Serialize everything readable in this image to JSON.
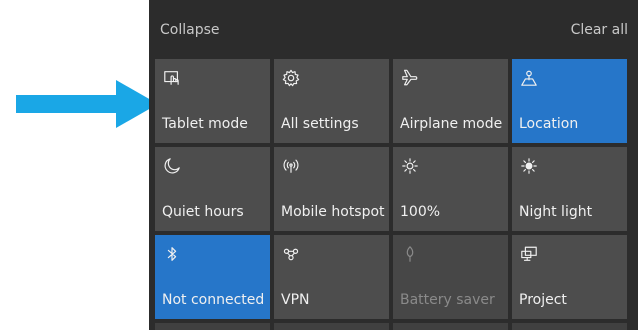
{
  "header": {
    "collapse_label": "Collapse",
    "clear_all_label": "Clear all"
  },
  "tiles": [
    {
      "label": "Tablet mode",
      "icon": "tablet-mode-icon",
      "state": "off"
    },
    {
      "label": "All settings",
      "icon": "gear-icon",
      "state": "off"
    },
    {
      "label": "Airplane mode",
      "icon": "airplane-icon",
      "state": "off"
    },
    {
      "label": "Location",
      "icon": "location-icon",
      "state": "on"
    },
    {
      "label": "Quiet hours",
      "icon": "moon-icon",
      "state": "off"
    },
    {
      "label": "Mobile hotspot",
      "icon": "hotspot-icon",
      "state": "off"
    },
    {
      "label": "100%",
      "icon": "brightness-icon",
      "state": "off"
    },
    {
      "label": "Night light",
      "icon": "night-light-icon",
      "state": "off"
    },
    {
      "label": "Not connected",
      "icon": "bluetooth-icon",
      "state": "on"
    },
    {
      "label": "VPN",
      "icon": "vpn-icon",
      "state": "off"
    },
    {
      "label": "Battery saver",
      "icon": "battery-saver-icon",
      "state": "disabled"
    },
    {
      "label": "Project",
      "icon": "project-icon",
      "state": "off"
    }
  ],
  "colors": {
    "arrow": "#1aa7e6",
    "panel_bg": "#2c2c2c",
    "tile_bg": "#4d4d4d",
    "tile_active": "#2676c9"
  }
}
